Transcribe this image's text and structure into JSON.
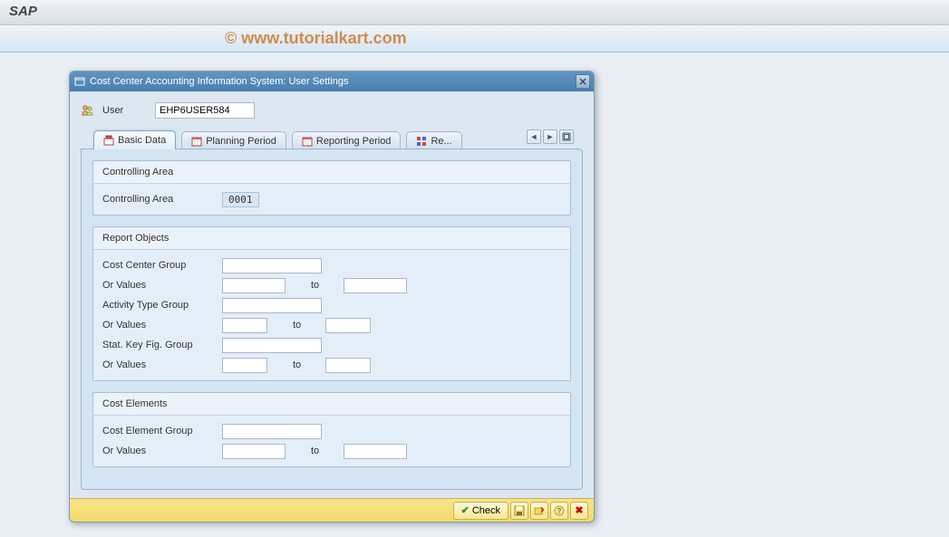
{
  "app": {
    "title": "SAP"
  },
  "watermark": "www.tutorialkart.com",
  "dialog": {
    "title": "Cost Center Accounting Information System: User Settings",
    "user_label": "User",
    "user_value": "EHP6USER584",
    "tabs": {
      "basic": "Basic Data",
      "planning": "Planning Period",
      "reporting": "Reporting Period",
      "re": "Re..."
    },
    "groups": {
      "ctrl_area": {
        "title": "Controlling Area",
        "field": "Controlling Area",
        "value": "0001"
      },
      "report_objects": {
        "title": "Report Objects",
        "cost_center_group": "Cost Center Group",
        "or_values": "Or Values",
        "to": "to",
        "activity_type_group": "Activity Type Group",
        "stat_key_fig_group": "Stat. Key Fig. Group"
      },
      "cost_elements": {
        "title": "Cost Elements",
        "cost_element_group": "Cost Element Group",
        "or_values": "Or Values",
        "to": "to"
      }
    },
    "footer": {
      "check": "Check"
    }
  }
}
